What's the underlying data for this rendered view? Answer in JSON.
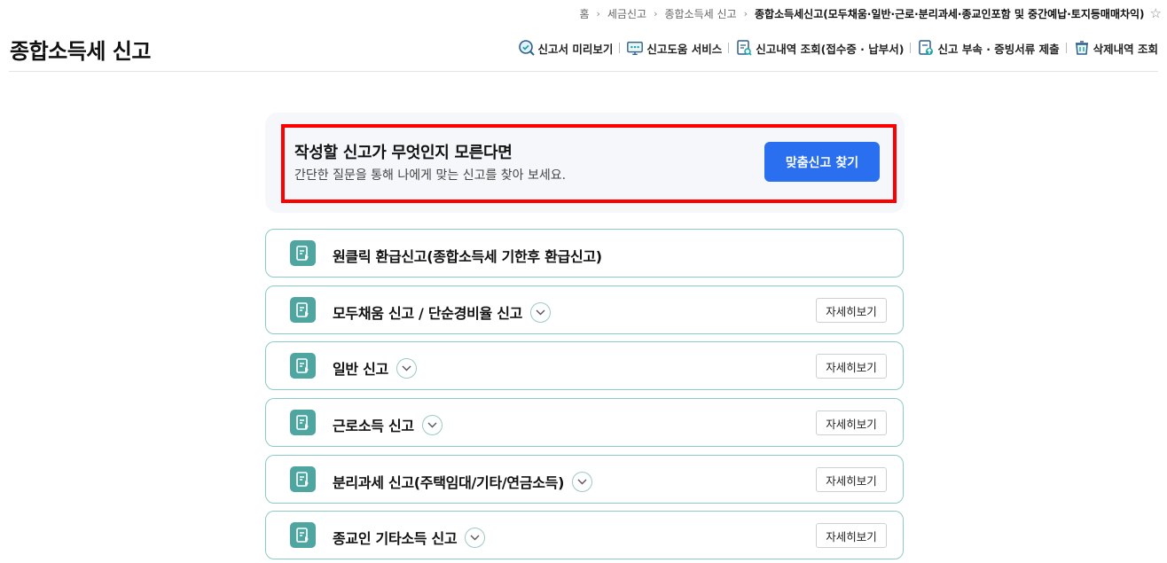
{
  "breadcrumb": {
    "items": [
      "홈",
      "세금신고",
      "종합소득세 신고"
    ],
    "current": "종합소득세신고(모두채움·일반·근로·분리과세·종교인포함 및 중간예납·토지등매매차익)"
  },
  "header": {
    "title": "종합소득세 신고",
    "tools": [
      {
        "label": "신고서 미리보기",
        "icon": "magnifier-check-icon"
      },
      {
        "label": "신고도움 서비스",
        "icon": "monitor-help-icon"
      },
      {
        "label": "신고내역 조회(접수증 · 납부서)",
        "icon": "document-search-icon"
      },
      {
        "label": "신고 부속 · 증빙서류 제출",
        "icon": "document-upload-icon"
      },
      {
        "label": "삭제내역 조회",
        "icon": "trash-icon"
      }
    ]
  },
  "banner": {
    "title": "작성할 신고가 무엇인지 모른다면",
    "subtitle": "간단한 질문을 통해 나에게 맞는 신고를 찾아 보세요.",
    "button": "맞춤신고 찾기"
  },
  "report_list": {
    "detail_label": "자세히보기",
    "items": [
      {
        "label": "원클릭 환급신고(종합소득세 기한후 환급신고)"
      },
      {
        "label": "모두채움 신고 / 단순경비율 신고"
      },
      {
        "label": "일반 신고"
      },
      {
        "label": "근로소득 신고"
      },
      {
        "label": "분리과세 신고(주택임대/기타/연금소득)"
      },
      {
        "label": "종교인 기타소득 신고"
      }
    ]
  },
  "colors": {
    "accent_button": "#2a6ff0",
    "card_border": "#8fcbc6",
    "card_icon": "#4fa6a1",
    "highlight": "#ff0000"
  }
}
